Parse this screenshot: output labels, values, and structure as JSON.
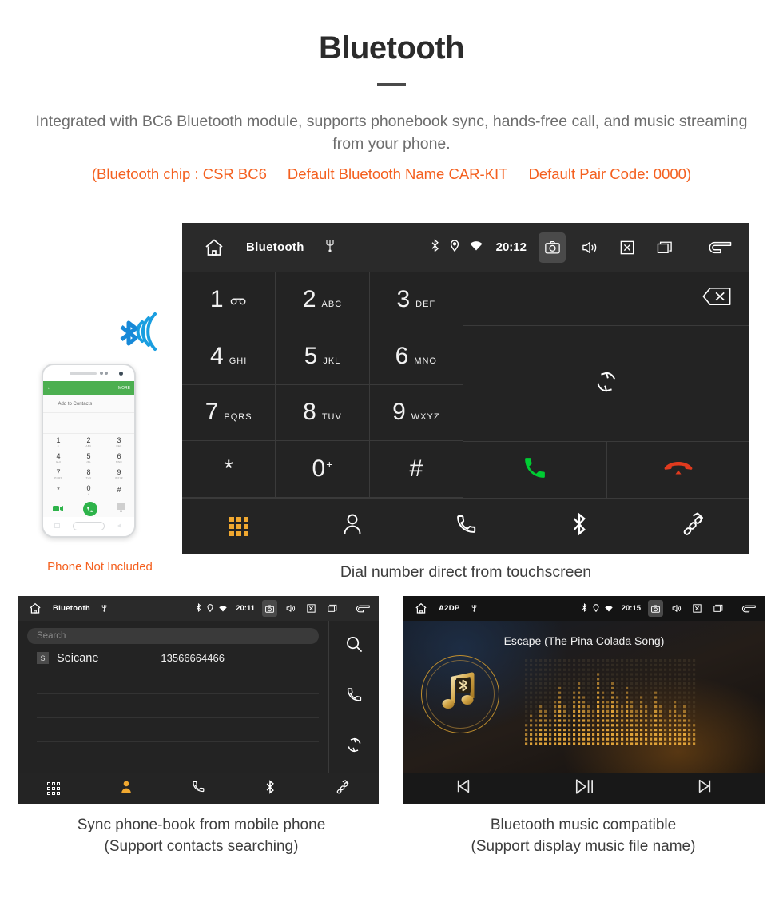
{
  "header": {
    "title": "Bluetooth",
    "description": "Integrated with BC6 Bluetooth module, supports phonebook sync, hands-free call, and music streaming from your phone.",
    "spec_open": "(Bluetooth chip : CSR BC6",
    "spec_name": "Default Bluetooth Name CAR-KIT",
    "spec_pair": "Default Pair Code: 0000)"
  },
  "colors": {
    "accent_orange": "#f4601f",
    "tab_active": "#f0a830",
    "call_green": "#00cc33",
    "end_red": "#e03a1e",
    "bluetooth_blue": "#1a9ee0",
    "gold": "#c08f2e"
  },
  "dialer": {
    "statusbar": {
      "home_icon": "home-icon",
      "title": "Bluetooth",
      "usb_icon": "usb-icon",
      "bluetooth_icon": "bluetooth-icon",
      "location_icon": "location-icon",
      "wifi_icon": "wifi-icon",
      "time": "20:12",
      "camera_icon": "camera-icon",
      "volume_icon": "volume-icon",
      "close_icon": "close-box-icon",
      "recents_icon": "recents-icon",
      "back_icon": "back-icon"
    },
    "keys": [
      {
        "digit": "1",
        "letters": "",
        "voicemail": true
      },
      {
        "digit": "2",
        "letters": "ABC"
      },
      {
        "digit": "3",
        "letters": "DEF"
      },
      {
        "digit": "4",
        "letters": "GHI"
      },
      {
        "digit": "5",
        "letters": "JKL"
      },
      {
        "digit": "6",
        "letters": "MNO"
      },
      {
        "digit": "7",
        "letters": "PQRS"
      },
      {
        "digit": "8",
        "letters": "TUV"
      },
      {
        "digit": "9",
        "letters": "WXYZ"
      },
      {
        "digit": "*",
        "letters": ""
      },
      {
        "digit": "0",
        "letters": "",
        "plus": "+"
      },
      {
        "digit": "#",
        "letters": ""
      }
    ],
    "number_input": "",
    "backspace_icon": "backspace-icon",
    "sync_icon": "sync-icon",
    "call_icon": "call-icon",
    "end_call_icon": "end-call-icon",
    "tabs": [
      {
        "name": "dialpad",
        "icon": "dialpad-icon",
        "active": true
      },
      {
        "name": "contacts",
        "icon": "person-icon",
        "active": false
      },
      {
        "name": "call-history",
        "icon": "phone-icon",
        "active": false
      },
      {
        "name": "bluetooth",
        "icon": "bluetooth-icon",
        "active": false
      },
      {
        "name": "pair-link",
        "icon": "link-icon",
        "active": false
      }
    ],
    "caption": "Dial number direct from touchscreen"
  },
  "phone_mock": {
    "appbar_back": "←",
    "appbar_more": "MORE",
    "add_contact": "Add to Contacts",
    "keys": [
      {
        "digit": "1",
        "letters": "∞"
      },
      {
        "digit": "2",
        "letters": "ABC"
      },
      {
        "digit": "3",
        "letters": "DEF"
      },
      {
        "digit": "4",
        "letters": "GHI"
      },
      {
        "digit": "5",
        "letters": "JKL"
      },
      {
        "digit": "6",
        "letters": "MNO"
      },
      {
        "digit": "7",
        "letters": "PQRS"
      },
      {
        "digit": "8",
        "letters": "TUV"
      },
      {
        "digit": "9",
        "letters": "WXYZ"
      },
      {
        "digit": "*",
        "letters": ""
      },
      {
        "digit": "0",
        "letters": "+"
      },
      {
        "digit": "#",
        "letters": ""
      }
    ],
    "caption": "Phone Not Included"
  },
  "contacts_unit": {
    "statusbar": {
      "title": "Bluetooth",
      "time": "20:11"
    },
    "search_placeholder": "Search",
    "rows": [
      {
        "badge": "S",
        "name": "Seicane",
        "number": "13566664466"
      }
    ],
    "side_icons": [
      {
        "name": "search-icon"
      },
      {
        "name": "call-icon"
      },
      {
        "name": "sync-icon"
      }
    ],
    "tabs": [
      {
        "name": "dialpad",
        "active": false
      },
      {
        "name": "contacts",
        "active": true
      },
      {
        "name": "call-history",
        "active": false
      },
      {
        "name": "bluetooth",
        "active": false
      },
      {
        "name": "pair-link",
        "active": false
      }
    ],
    "caption_line1": "Sync phone-book from mobile phone",
    "caption_line2": "(Support contacts searching)"
  },
  "music_unit": {
    "statusbar": {
      "title": "A2DP",
      "time": "20:15"
    },
    "track_title": "Escape (The Pina Colada Song)",
    "album_icon": "music-note-bluetooth-icon",
    "controls": [
      {
        "name": "previous-track-button",
        "icon": "skip-previous-icon"
      },
      {
        "name": "play-pause-button",
        "icon": "play-pause-icon"
      },
      {
        "name": "next-track-button",
        "icon": "skip-next-icon"
      }
    ],
    "caption_line1": "Bluetooth music compatible",
    "caption_line2": "(Support display music file name)"
  }
}
